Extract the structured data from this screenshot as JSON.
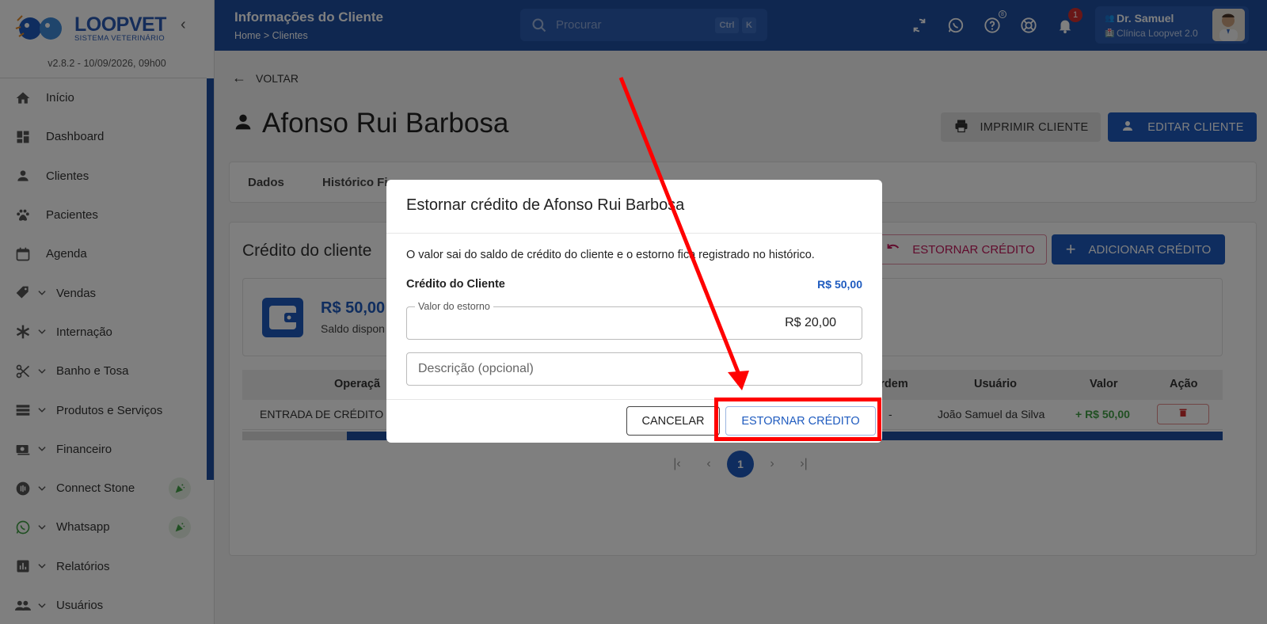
{
  "app": {
    "logo_title": "LOOPVET",
    "logo_subtitle": "SISTEMA VETERINÁRIO",
    "version": "v2.8.2 - 10/09/2026, 09h00"
  },
  "sidebar": {
    "items": [
      {
        "label": "Início",
        "icon": "home-icon"
      },
      {
        "label": "Dashboard",
        "icon": "dashboard-icon"
      },
      {
        "label": "Clientes",
        "icon": "person-icon"
      },
      {
        "label": "Pacientes",
        "icon": "paw-icon"
      },
      {
        "label": "Agenda",
        "icon": "calendar-icon"
      },
      {
        "label": "Vendas",
        "icon": "tag-icon"
      },
      {
        "label": "Internação",
        "icon": "asterisk-icon"
      },
      {
        "label": "Banho e Tosa",
        "icon": "scissors-icon"
      },
      {
        "label": "Produtos e Serviços",
        "icon": "list-icon"
      },
      {
        "label": "Financeiro",
        "icon": "money-icon"
      },
      {
        "label": "Connect Stone",
        "icon": "nfc-icon"
      },
      {
        "label": "Whatsapp",
        "icon": "whatsapp-icon"
      },
      {
        "label": "Relatórios",
        "icon": "chart-icon"
      },
      {
        "label": "Usuários",
        "icon": "users-icon"
      }
    ]
  },
  "header": {
    "title": "Informações do Cliente",
    "breadcrumb": "Home  >  Clientes",
    "search_placeholder": "Procurar",
    "kbd_ctrl": "Ctrl",
    "kbd_k": "K",
    "notif_count": "1",
    "help_badge": "8",
    "user_name": "Dr. Samuel",
    "user_clinic": "Clínica Loopvet 2.0"
  },
  "main": {
    "back_label": "VOLTAR",
    "client_name": "Afonso Rui Barbosa",
    "print_label": "IMPRIMIR CLIENTE",
    "edit_label": "EDITAR CLIENTE",
    "tabs": [
      "Dados",
      "Histórico Fi"
    ],
    "card_title": "Crédito do cliente",
    "estornar_label": "ESTORNAR CRÉDITO",
    "add_label": "ADICIONAR CRÉDITO",
    "balance_value": "R$ 50,00",
    "balance_label": "Saldo dispon",
    "table": {
      "headers": [
        "Operaçã",
        "Ordem",
        "Usuário",
        "Valor",
        "Ação"
      ],
      "row": {
        "operation": "ENTRADA DE CRÉDITO",
        "order": "-",
        "user": "João Samuel da Silva",
        "value": "+ R$ 50,00"
      }
    },
    "pager": {
      "first": "|‹",
      "prev": "‹",
      "page": "1",
      "next": "›",
      "last": "›|"
    }
  },
  "dialog": {
    "title": "Estornar crédito de Afonso Rui Barbosa",
    "message": "O valor sai do saldo de crédito do cliente e o estorno fica registrado no histórico.",
    "credit_label": "Crédito do Cliente",
    "credit_value": "R$ 50,00",
    "amount_legend": "Valor do estorno",
    "amount_value": "R$ 20,00",
    "description_placeholder": "Descrição (opcional)",
    "cancel_label": "CANCELAR",
    "confirm_label": "ESTORNAR CRÉDITO"
  },
  "colors": {
    "brand": "#1f4fa0",
    "accent": "#1f5bbf",
    "annotation": "#ff0000"
  }
}
